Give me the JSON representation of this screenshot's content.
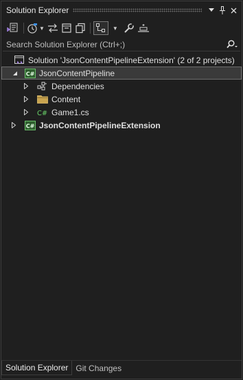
{
  "window": {
    "title": "Solution Explorer",
    "buttons": {
      "menu": "▾",
      "pin": "pin",
      "close": "×"
    }
  },
  "toolbar": {
    "items": [
      {
        "name": "switch-views",
        "icon": "vs-solution-switch-icon"
      },
      {
        "name": "pending-changes-filter",
        "icon": "clock-icon"
      },
      {
        "name": "sync-with-active-document",
        "icon": "sync-arrows-icon"
      },
      {
        "name": "collapse-all",
        "icon": "collapse-icon"
      },
      {
        "name": "show-all-files",
        "icon": "copy-files-icon"
      },
      {
        "name": "view-hierarchy",
        "icon": "hierarchy-icon",
        "active": true
      },
      {
        "name": "properties",
        "icon": "wrench-icon"
      },
      {
        "name": "preview-selected",
        "icon": "preview-icon"
      }
    ]
  },
  "search": {
    "placeholder": "Search Solution Explorer (Ctrl+;)",
    "value": ""
  },
  "tree": {
    "solution": "Solution 'JsonContentPipelineExtension' (2 of 2 projects)",
    "project1": "JsonContentPipeline",
    "dependencies": "Dependencies",
    "content": "Content",
    "game1": "Game1.cs",
    "project2": "JsonContentPipelineExtension"
  },
  "tabs": {
    "solution_explorer": "Solution Explorer",
    "git_changes": "Git Changes"
  },
  "colors": {
    "background": "#1f1f1f",
    "csharp_project": "#3f7f3f",
    "csharp_file": "#6ad36a",
    "solution_accent": "#9b7bd8",
    "folder": "#d8b35a"
  }
}
